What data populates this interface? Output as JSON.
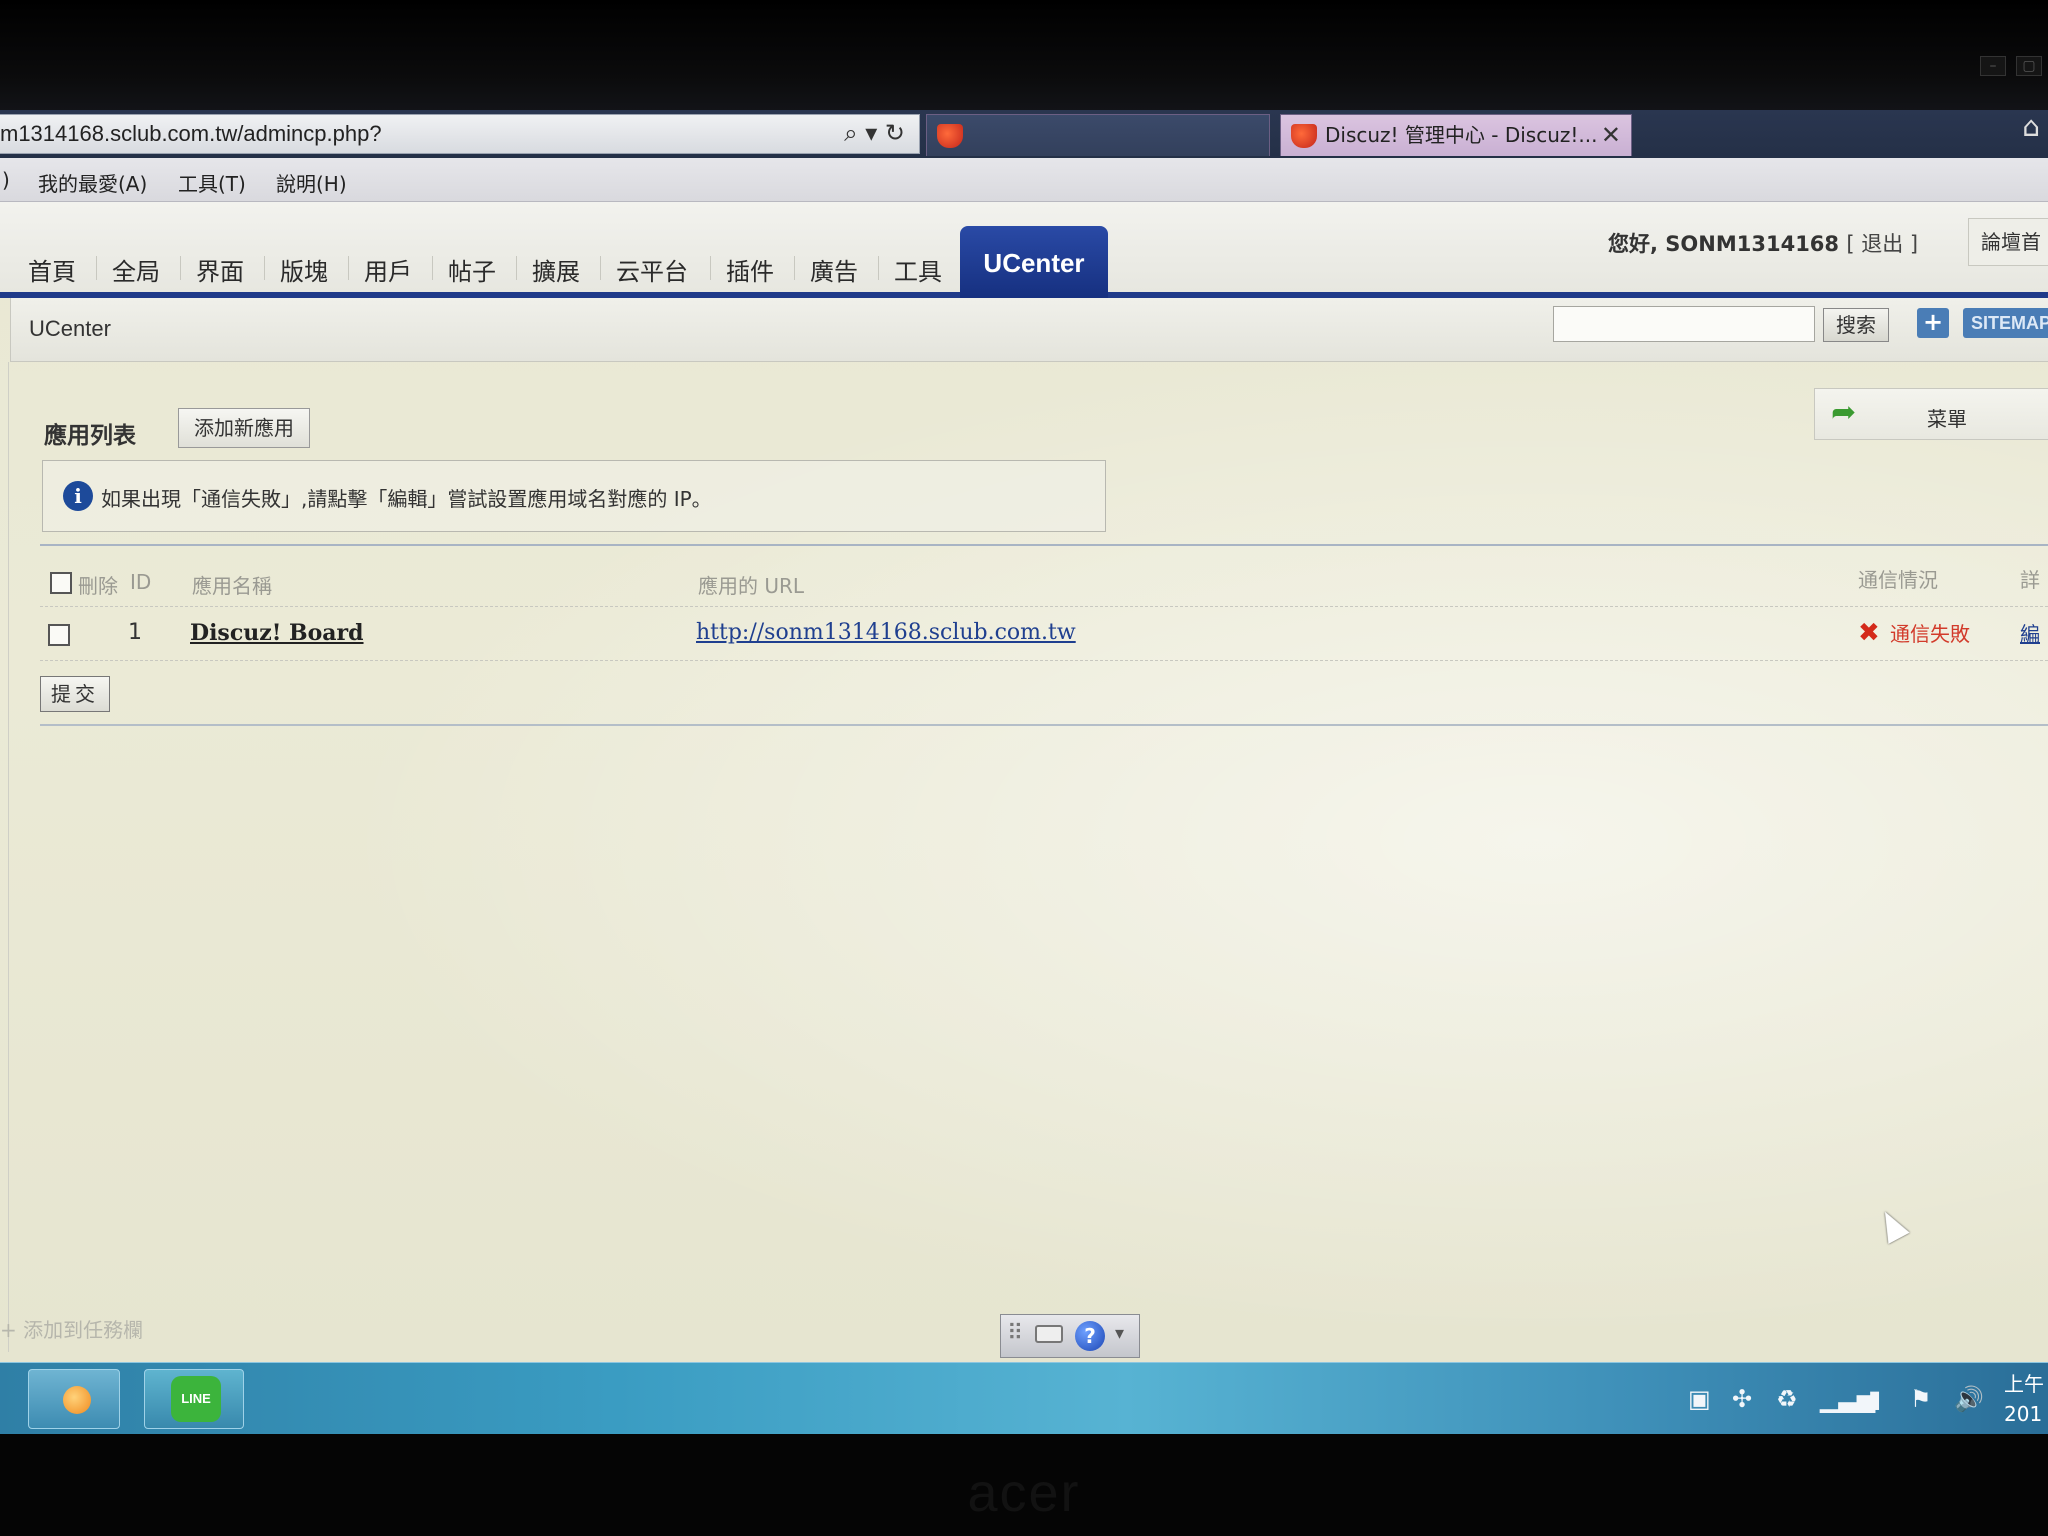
{
  "browser": {
    "address": "m1314168.sclub.com.tw/admincp.php?",
    "address_icons": "⌕ ▾ ↻",
    "tab_inactive_label": "",
    "tab_active_label": "Discuz! 管理中心 - Discuz!...",
    "tab_close": "✕",
    "home_icon": "⌂"
  },
  "window_controls": [
    "–",
    "▢"
  ],
  "menu_bar": {
    "items": [
      ")",
      "我的最愛(A)",
      "工具(T)",
      "說明(H)"
    ]
  },
  "nav": {
    "tabs": [
      "首頁",
      "全局",
      "界面",
      "版塊",
      "用戶",
      "帖子",
      "擴展",
      "云平台",
      "插件",
      "廣告",
      "工具"
    ],
    "active_tab": "UCenter",
    "greeting_prefix": "您好,",
    "username": "SONM1314168",
    "logout": "[ 退出 ]",
    "forum_home": "論壇首"
  },
  "sub_header": {
    "title": "UCenter",
    "search_value": "",
    "search_button": "搜索",
    "plus": "+",
    "sitemap": "SITEMAP"
  },
  "content": {
    "section_title": "應用列表",
    "add_button": "添加新應用",
    "menu_panel": "菜單",
    "info_icon": "i",
    "info_text": "如果出現「通信失敗」,請點擊「編輯」嘗試設置應用域名對應的 IP。",
    "table": {
      "headers": {
        "delete": "刪除",
        "id": "ID",
        "name": "應用名稱",
        "url": "應用的 URL",
        "status": "通信情況",
        "detail": "詳"
      },
      "rows": [
        {
          "id": "1",
          "name": "Discuz! Board",
          "url": "http://sonm1314168.sclub.com.tw",
          "status": "通信失敗",
          "status_icon": "✖",
          "edit": "編"
        }
      ]
    },
    "submit": "提交"
  },
  "taskbar_hint": "+ 添加到任務欄",
  "ime": {
    "grip": "⠿",
    "help": "?",
    "down": "▾"
  },
  "taskbar": {
    "line_label": "LINE",
    "clock_line1": "上午",
    "clock_line2": "201",
    "tray_icons": [
      "chat-icon",
      "network-settings-icon",
      "sync-icon",
      "signal-icon",
      "battery-icon",
      "flag-icon",
      "volume-icon"
    ]
  },
  "brand": "acer",
  "colors": {
    "accent": "#1f3a8a",
    "status_fail": "#d23a2a",
    "link": "#1f3f8f"
  }
}
